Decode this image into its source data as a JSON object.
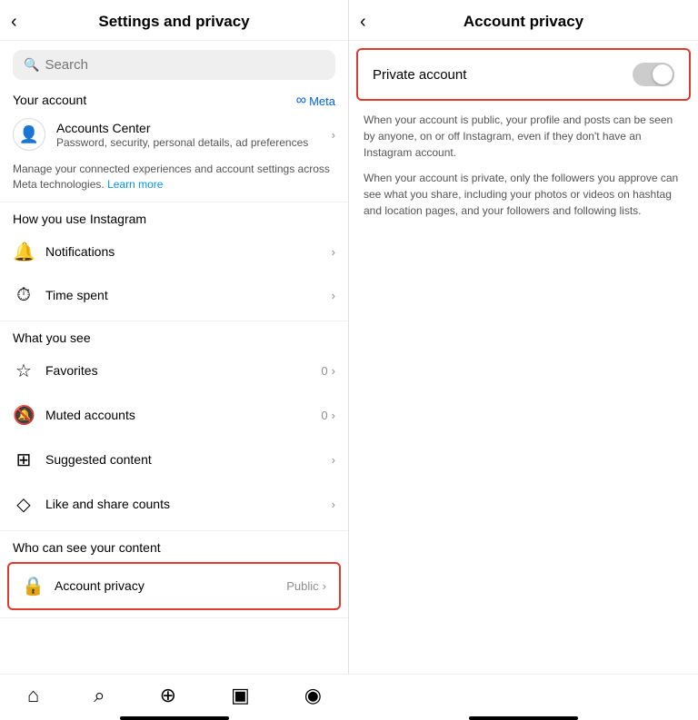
{
  "left": {
    "header": {
      "back_label": "‹",
      "title": "Settings and privacy"
    },
    "search": {
      "placeholder": "Search"
    },
    "your_account": {
      "label": "Your account",
      "meta_label": "Meta"
    },
    "accounts_center": {
      "title": "Accounts Center",
      "subtitle": "Password, security, personal details, ad preferences"
    },
    "manage_text": "Manage your connected experiences and account settings across Meta technologies.",
    "learn_more_label": "Learn more",
    "sections": [
      {
        "label": "How you use Instagram",
        "items": [
          {
            "icon": "🔔",
            "label": "Notifications",
            "badge": "",
            "chevron": "›"
          },
          {
            "icon": "⏱",
            "label": "Time spent",
            "badge": "",
            "chevron": "›"
          }
        ]
      },
      {
        "label": "What you see",
        "items": [
          {
            "icon": "☆",
            "label": "Favorites",
            "badge": "0",
            "chevron": "›"
          },
          {
            "icon": "🔕",
            "label": "Muted accounts",
            "badge": "0",
            "chevron": "›"
          },
          {
            "icon": "⊞",
            "label": "Suggested content",
            "badge": "",
            "chevron": "›"
          },
          {
            "icon": "◇",
            "label": "Like and share counts",
            "badge": "",
            "chevron": "›"
          }
        ]
      },
      {
        "label": "Who can see your content",
        "items": [
          {
            "icon": "🔒",
            "label": "Account privacy",
            "badge": "Public",
            "chevron": "›",
            "highlighted": true
          }
        ]
      }
    ]
  },
  "right": {
    "header": {
      "back_label": "‹",
      "title": "Account privacy"
    },
    "private_account": {
      "label": "Private account"
    },
    "description_1": "When your account is public, your profile and posts can be seen by anyone, on or off Instagram, even if they don't have an Instagram account.",
    "description_2": "When your account is private, only the followers you approve can see what you share, including your photos or videos on hashtag and location pages, and your followers and following lists."
  },
  "bottom_nav": {
    "icons": [
      "⌂",
      "⌕",
      "⊕",
      "⬛",
      "◉"
    ]
  }
}
